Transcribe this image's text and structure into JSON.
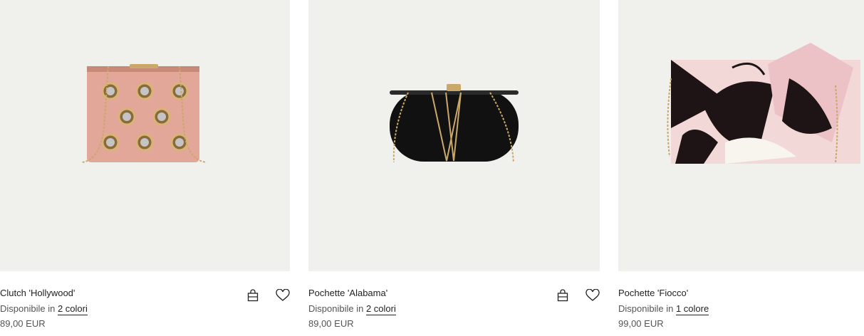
{
  "products": [
    {
      "name": "Clutch 'Hollywood'",
      "avail_prefix": "Disponibile in",
      "colors": "2 colori",
      "price": "89,00 EUR"
    },
    {
      "name": "Pochette 'Alabama'",
      "avail_prefix": "Disponibile in",
      "colors": "2 colori",
      "price": "89,00 EUR"
    },
    {
      "name": "Pochette 'Fiocco'",
      "avail_prefix": "Disponibile in",
      "colors": "1 colore",
      "price": "99,00 EUR"
    }
  ],
  "icons": {
    "bag": "shopping-bag-icon",
    "wishlist": "heart-icon"
  },
  "colors": {
    "image_bg": "#f0f0ed",
    "text": "#222222",
    "muted": "#555555"
  }
}
